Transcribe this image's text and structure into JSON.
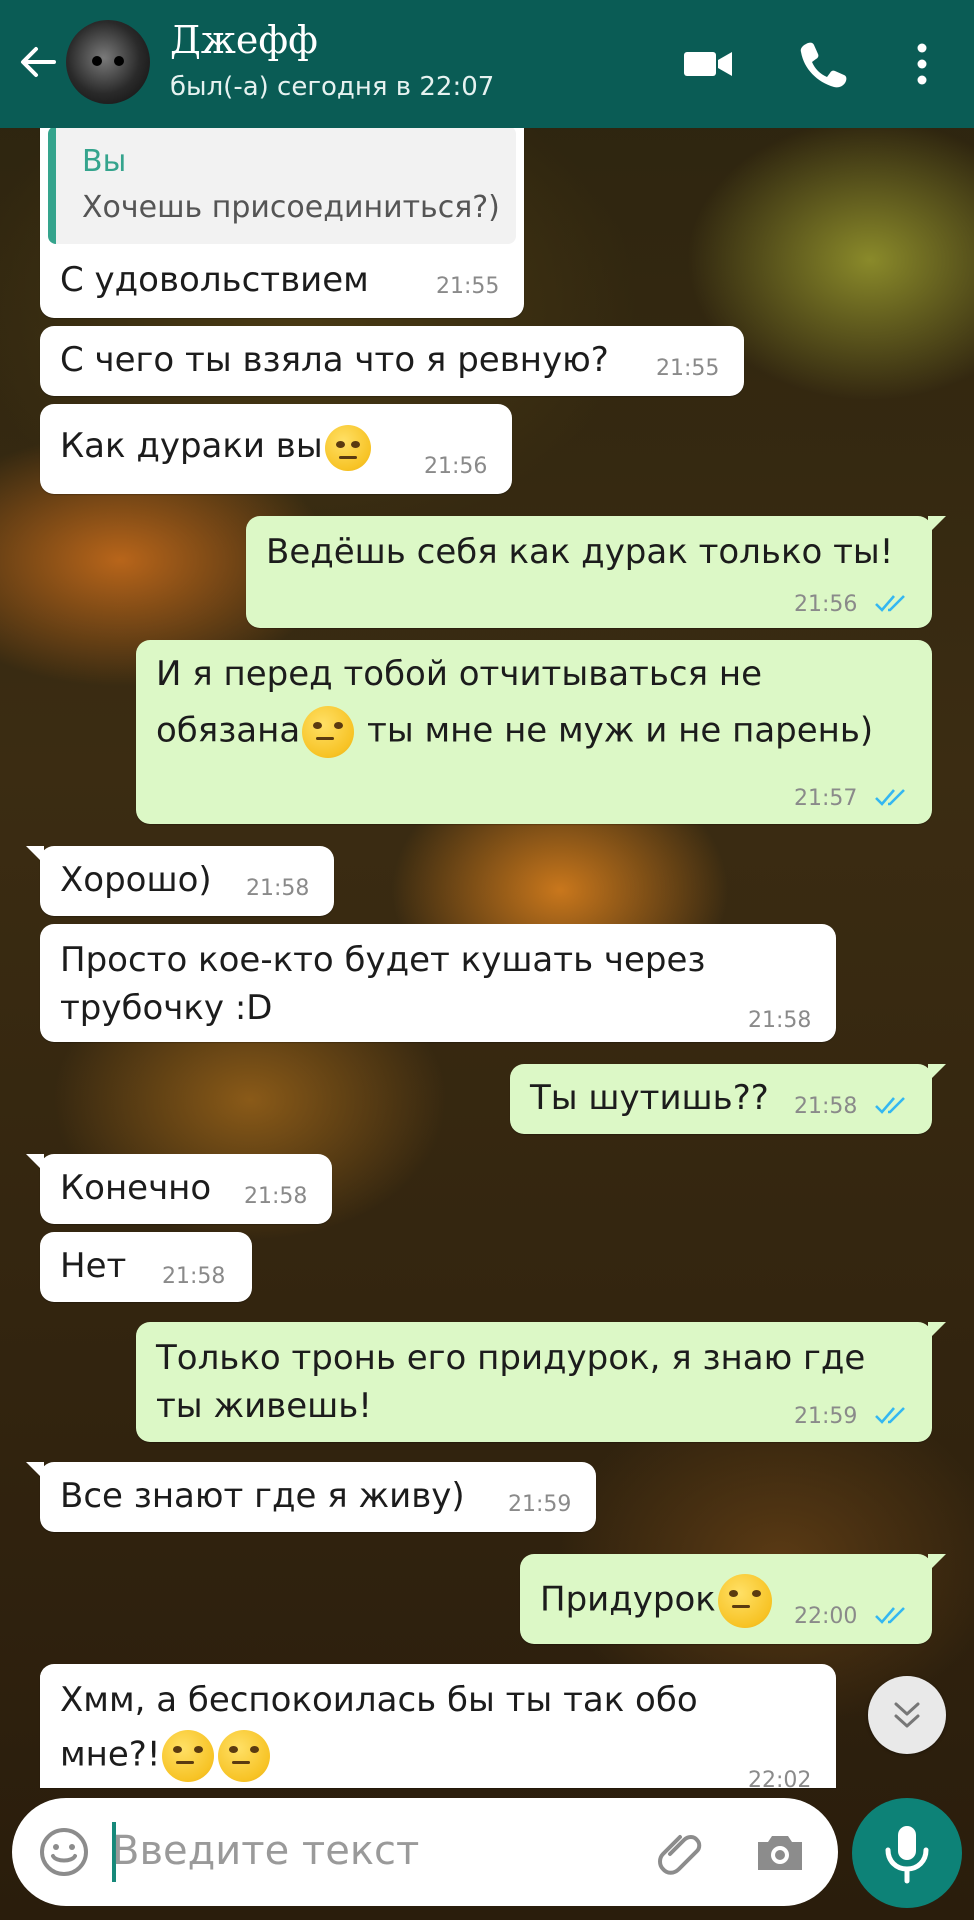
{
  "header": {
    "contact_name": "Джефф",
    "last_seen": "был(-а) сегодня в 22:07",
    "icons": [
      "back-arrow-icon",
      "video-call-icon",
      "phone-icon",
      "more-vertical-icon"
    ]
  },
  "messages": [
    {
      "dir": "in",
      "reply_author": "Вы",
      "reply_text": "Хочешь присоединиться?)",
      "lines": [
        "С удовольствием"
      ],
      "time": "21:55"
    },
    {
      "dir": "in",
      "lines": [
        "С чего ты взяла что я ревную?"
      ],
      "time": "21:55"
    },
    {
      "dir": "in",
      "lines": [
        "Как дураки вы"
      ],
      "emoji": "face-with-rolling-eyes",
      "time": "21:56"
    },
    {
      "dir": "out",
      "lines": [
        "Ведёшь себя как дурак только ты!"
      ],
      "time": "21:56",
      "status": "read"
    },
    {
      "dir": "out",
      "lines": [
        "И я перед тобой отчитываться не",
        "обязана",
        "ты мне не муж и не парень)"
      ],
      "emoji": "relieved-face",
      "time": "21:57",
      "status": "read"
    },
    {
      "dir": "in",
      "lines": [
        "Хорошо)"
      ],
      "time": "21:58"
    },
    {
      "dir": "in",
      "lines": [
        "Просто кое-кто будет кушать через",
        "трубочку :D"
      ],
      "time": "21:58"
    },
    {
      "dir": "out",
      "lines": [
        "Ты шутишь??"
      ],
      "time": "21:58",
      "status": "read"
    },
    {
      "dir": "in",
      "lines": [
        "Конечно"
      ],
      "time": "21:58"
    },
    {
      "dir": "in",
      "lines": [
        "Нет"
      ],
      "time": "21:58"
    },
    {
      "dir": "out",
      "lines": [
        "Только тронь его придурок, я знаю где",
        "ты живешь!"
      ],
      "time": "21:59",
      "status": "read"
    },
    {
      "dir": "in",
      "lines": [
        "Все знают где я живу)"
      ],
      "time": "21:59"
    },
    {
      "dir": "out",
      "lines": [
        "Придурок"
      ],
      "emoji": "face-with-rolling-eyes",
      "time": "22:00",
      "status": "read"
    },
    {
      "dir": "in",
      "lines": [
        "Хмм, а беспокоилась бы ты так обо",
        "мне?!"
      ],
      "emoji": "face-with-raised-eyebrow, thinking-face",
      "time": "22:02"
    }
  ],
  "input": {
    "placeholder": "Введите текст",
    "icons": [
      "emoji-icon",
      "attach-icon",
      "camera-icon",
      "mic-icon"
    ]
  },
  "colors": {
    "header": "#0a5c55",
    "incoming": "#ffffff",
    "outgoing": "#dcf8c6",
    "read_ticks": "#34b7f1",
    "accent": "#0d8277"
  }
}
